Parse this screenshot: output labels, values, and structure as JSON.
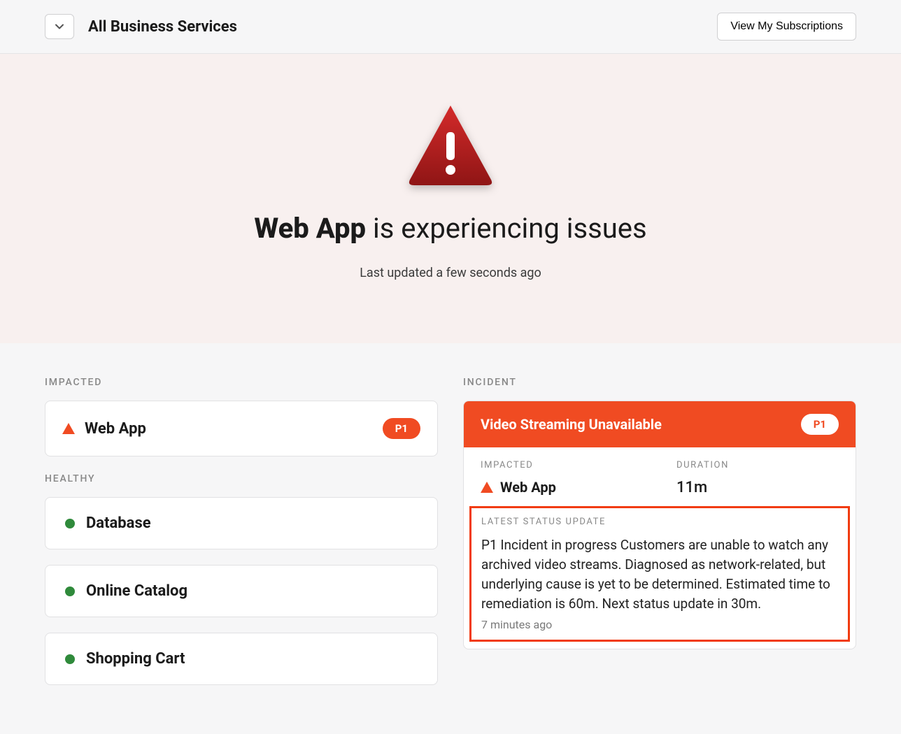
{
  "topbar": {
    "title": "All Business Services",
    "subscriptions_label": "View My Subscriptions"
  },
  "hero": {
    "service_name": "Web App",
    "status_suffix": " is experiencing issues",
    "last_updated": "Last updated a few seconds ago"
  },
  "sections": {
    "impacted_label": "IMPACTED",
    "healthy_label": "HEALTHY",
    "incident_label": "INCIDENT"
  },
  "impacted": [
    {
      "name": "Web App",
      "priority": "P1"
    }
  ],
  "healthy": [
    {
      "name": "Database"
    },
    {
      "name": "Online Catalog"
    },
    {
      "name": "Shopping Cart"
    }
  ],
  "incident": {
    "title": "Video Streaming Unavailable",
    "priority": "P1",
    "impacted_label": "IMPACTED",
    "impacted_service": "Web App",
    "duration_label": "DURATION",
    "duration_value": "11m",
    "status_update_label": "LATEST STATUS UPDATE",
    "status_update_text": "P1 Incident in progress Customers are unable to watch any archived video streams. Diagnosed as network-related, but underlying cause is yet to be determined. Estimated time to remediation is 60m. Next status update in 30m.",
    "status_update_time": "7 minutes ago"
  },
  "colors": {
    "alert": "#f04b22",
    "alert_dark": "#a81d1d",
    "healthy": "#2f8a3b"
  }
}
